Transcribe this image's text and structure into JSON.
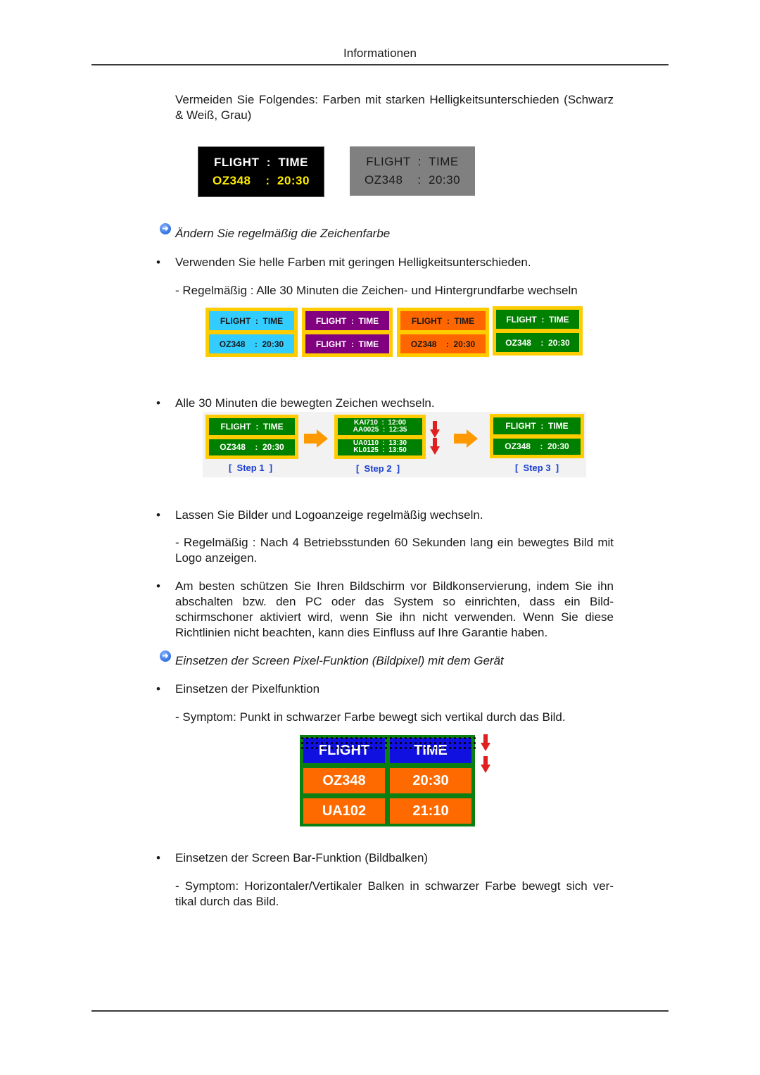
{
  "header": {
    "title": "Informationen"
  },
  "intro": {
    "text": "Vermeiden Sie Folgendes: Farben mit starken Helligkeitsunterschieden (Schwarz & Weiß, Grau)"
  },
  "contrast_examples": [
    {
      "line1": "FLIGHT  :  TIME",
      "line2": "OZ348    :  20:30",
      "bg": "#000000",
      "line1_color": "#ffffff",
      "line2_color": "#ffee00"
    },
    {
      "line1": "FLIGHT  :  TIME",
      "line2": "OZ348    :  20:30",
      "bg": "#808080",
      "line1_color": "#1a1a1a",
      "line2_color": "#1a1a1a"
    }
  ],
  "section1": {
    "icon": "arrow-right-circle-icon",
    "heading": "Ändern Sie regelmäßig die Zeichenfarbe",
    "bullet1": "Verwenden Sie helle Farben mit geringen Helligkeitsunterschieden.",
    "sub1": "- Regelmäßig : Alle 30 Minuten die Zeichen- und Hintergrundfarbe wechseln",
    "color_boards": [
      {
        "top": "FLIGHT  :  TIME",
        "bottom": "OZ348    :  20:30",
        "bg": "#33ccff",
        "fg": "#1a1a1a"
      },
      {
        "top": "FLIGHT  :  TIME",
        "bottom": "FLIGHT  :  TIME",
        "bg": "#800080",
        "fg": "#ffffff"
      },
      {
        "top": "FLIGHT  :  TIME",
        "bottom": "OZ348    :  20:30",
        "bg": "#ff6600",
        "fg": "#1a1a1a"
      },
      {
        "top": "FLIGHT  :  TIME",
        "bottom": "OZ348    :  20:30",
        "bg": "#008000",
        "fg": "#ffffff"
      }
    ],
    "bullet2": "Alle 30 Minuten die bewegten Zeichen wechseln.",
    "steps": [
      {
        "label": "[  Step 1  ]",
        "top": "FLIGHT  :  TIME",
        "bottom": "OZ348    :  20:30"
      },
      {
        "label": "[  Step 2  ]",
        "top": "KAI710  :  12:00\nAA0025  :  12:35",
        "bottom": "UA0110  :  13:30\nKL0125  :  13:50"
      },
      {
        "label": "[  Step 3  ]",
        "top": "FLIGHT  :  TIME",
        "bottom": "OZ348    :  20:30"
      }
    ],
    "bullet3": "Lassen Sie Bilder und Logoanzeige regelmäßig wechseln.",
    "sub3": "- Regelmäßig : Nach 4 Betriebsstunden 60 Sekunden lang ein bewegtes Bild mit Logo anzeigen.",
    "bullet4": "Am besten schützen Sie Ihren Bildschirm vor Bildkonservierung, indem Sie ihn abschalten bzw. den PC oder das System so einrichten, dass ein Bild- schirmschoner aktiviert wird, wenn Sie ihn nicht verwenden. Wenn Sie diese Richtlinien nicht beachten, kann dies Einfluss auf Ihre Garantie haben."
  },
  "section2": {
    "icon": "arrow-right-circle-icon",
    "heading": "Einsetzen der Screen Pixel-Funktion (Bildpixel) mit dem Gerät",
    "bullet1": "Einsetzen der Pixelfunktion",
    "sub1": "- Symptom: Punkt in schwarzer Farbe bewegt sich vertikal durch das Bild.",
    "pixel_board": {
      "header": [
        "FLIGHT",
        "TIME"
      ],
      "rows": [
        [
          "OZ348",
          "20:30"
        ],
        [
          "UA102",
          "21:10"
        ]
      ]
    },
    "bullet2": "Einsetzen der Screen Bar-Funktion (Bildbalken)",
    "sub2": "- Symptom: Horizontaler/Vertikaler Balken in schwarzer Farbe bewegt sich ver- tikal durch das Bild."
  },
  "bullet_char": "•"
}
